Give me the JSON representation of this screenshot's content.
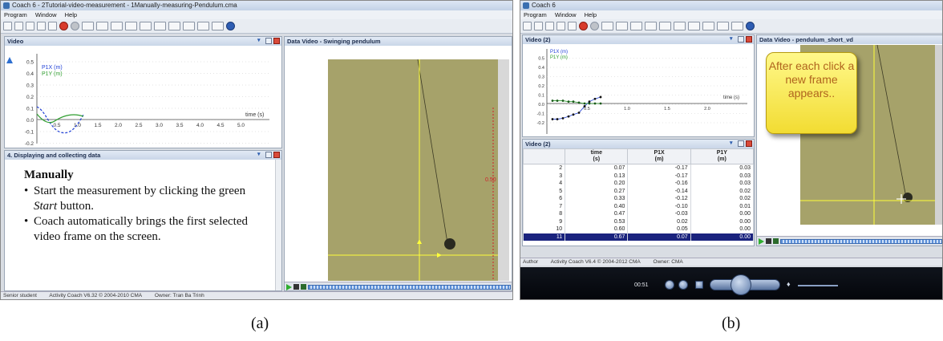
{
  "panel_a": {
    "window_title": "Coach 6 - 2Tutorial-video-measurement - 1Manually-measuring-Pendulum.cma",
    "menu": [
      "Program",
      "Window",
      "Help"
    ],
    "graph_pane_title": "Video",
    "video_pane_title": "Data Video - Swinging pendulum",
    "instr_pane_title": "4. Displaying and collecting data",
    "legend": [
      "P1X (m)",
      "P1Y (m)"
    ],
    "x_axis_label": "time (s)",
    "y_ticks": [
      "0.5",
      "0.4",
      "0.3",
      "0.2",
      "0.1",
      "0.0",
      "-0.1",
      "-0.2"
    ],
    "x_ticks": [
      "0.5",
      "1.0",
      "1.5",
      "2.0",
      "2.5",
      "3.0",
      "3.5",
      "4.0",
      "4.5",
      "5.0"
    ],
    "doc_heading": "Manually",
    "doc_bullets": [
      {
        "pre": "Start the measurement by clicking the green ",
        "em": "Start",
        "post": " button."
      },
      {
        "pre": "Coach automatically brings the first selected video frame on the screen.",
        "em": "",
        "post": ""
      }
    ],
    "video_mark": "0.50",
    "status": [
      "Senior student",
      "Activity   Coach V6.32 © 2004-2010 CMA",
      "Owner: Tran Ba Trinh"
    ],
    "caption": "(a)"
  },
  "panel_b": {
    "window_title": "Coach 6",
    "menu": [
      "Program",
      "Window",
      "Help"
    ],
    "graph_pane_title": "Video (2)",
    "video_pane_title": "Data Video - pendulum_short_vd",
    "table_pane_title": "Video (2)",
    "legend": [
      "P1X (m)",
      "P1Y (m)"
    ],
    "x_axis_label": "time (s)",
    "y_ticks": [
      "0.5",
      "0.4",
      "0.3",
      "0.2",
      "0.1",
      "0.0",
      "-0.1",
      "-0.2"
    ],
    "x_ticks": [
      "0.5",
      "1.0",
      "1.5",
      "2.0"
    ],
    "table": {
      "headers": [
        [
          "",
          ""
        ],
        [
          "time",
          "(s)"
        ],
        [
          "P1X",
          "(m)"
        ],
        [
          "P1Y",
          "(m)"
        ]
      ],
      "rows": [
        [
          "2",
          "0.07",
          "-0.17",
          "0.03"
        ],
        [
          "3",
          "0.13",
          "-0.17",
          "0.03"
        ],
        [
          "4",
          "0.20",
          "-0.16",
          "0.03"
        ],
        [
          "5",
          "0.27",
          "-0.14",
          "0.02"
        ],
        [
          "6",
          "0.33",
          "-0.12",
          "0.02"
        ],
        [
          "7",
          "0.40",
          "-0.10",
          "0.01"
        ],
        [
          "8",
          "0.47",
          "-0.03",
          "0.00"
        ],
        [
          "9",
          "0.53",
          "0.02",
          "0.00"
        ],
        [
          "10",
          "0.60",
          "0.05",
          "0.00"
        ],
        [
          "11",
          "0.67",
          "0.07",
          "0.00"
        ]
      ],
      "selected_row": 9
    },
    "tooltip": "After each click a new frame appears..",
    "status": [
      "Author",
      "Activity   Coach V6.4 © 2004-2012 CMA",
      "Owner: CMA"
    ],
    "player_time": "00:51",
    "caption": "(b)"
  }
}
